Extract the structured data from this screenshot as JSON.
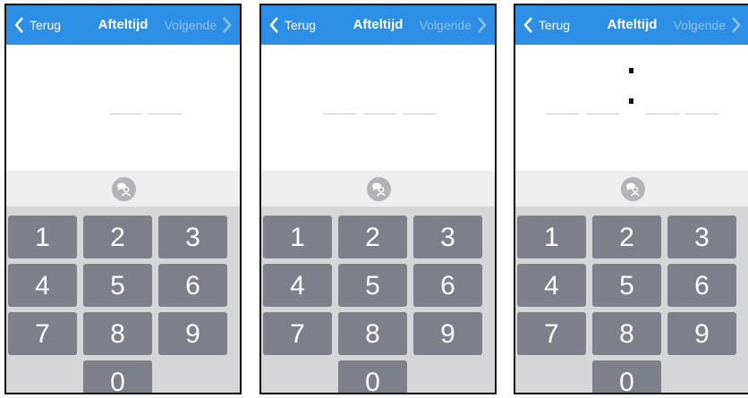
{
  "screens": [
    {
      "nav": {
        "back_label": "Terug",
        "title": "Afteltijd",
        "next_label": "Volgende"
      },
      "keys": [
        "1",
        "2",
        "3",
        "4",
        "5",
        "6",
        "7",
        "8",
        "9",
        "0"
      ]
    },
    {
      "nav": {
        "back_label": "Terug",
        "title": "Afteltijd",
        "next_label": "Volgende"
      },
      "keys": [
        "1",
        "2",
        "3",
        "4",
        "5",
        "6",
        "7",
        "8",
        "9",
        "0"
      ]
    },
    {
      "nav": {
        "back_label": "Terug",
        "title": "Afteltijd",
        "next_label": "Volgende"
      },
      "keys": [
        "1",
        "2",
        "3",
        "4",
        "5",
        "6",
        "7",
        "8",
        "9",
        "0"
      ]
    }
  ],
  "icons": {
    "back": "chevron-left-icon",
    "next": "chevron-right-icon",
    "voice": "speech-bubble-person-icon"
  },
  "colors": {
    "nav_bar": "#2d8ee6",
    "next_disabled": "#8ec0f2",
    "key_bg": "#7d7f8a",
    "keypad_bg": "#d6d6d8",
    "strip_bg": "#eeeeee"
  }
}
